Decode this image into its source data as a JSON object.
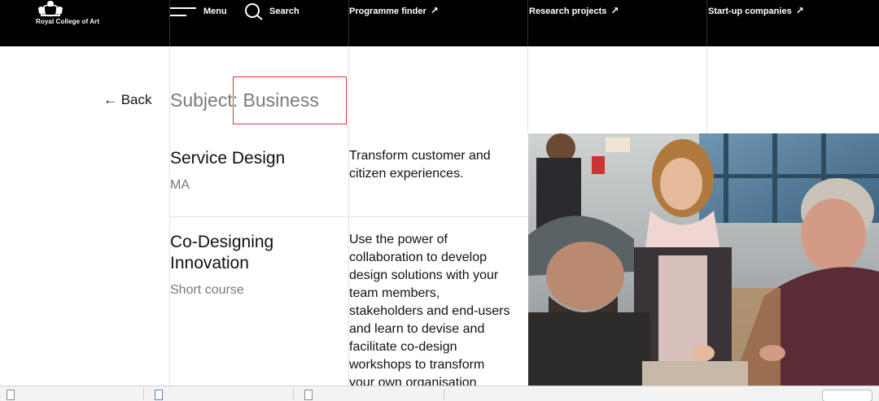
{
  "header": {
    "logo_text": "Royal College of Art",
    "menu_label": "Menu",
    "search_label": "Search",
    "nav": [
      {
        "label": "Programme finder",
        "arrow": "↗"
      },
      {
        "label": "Research projects",
        "arrow": "↗"
      },
      {
        "label": "Start-up companies",
        "arrow": "↗"
      }
    ]
  },
  "page": {
    "back_label": "← Back",
    "subject_title": "Subject: Business"
  },
  "courses": [
    {
      "title": "Service Design",
      "type": "MA",
      "description": "Transform customer and citizen experiences."
    },
    {
      "title": "Co-Designing Innovation",
      "type": "Short course",
      "description": "Use the power of collaboration to develop design solutions with your team members, stakeholders and end-users and learn to devise and facilitate co-design workshops to transform your own organisation"
    }
  ],
  "colors": {
    "header_bg": "#000000",
    "highlight": "#d83a3a",
    "muted_text": "#7a7a7a"
  },
  "icons": [
    "menu-icon",
    "search-icon",
    "arrow-up-right-icon",
    "back-arrow-icon",
    "crest-icon"
  ]
}
